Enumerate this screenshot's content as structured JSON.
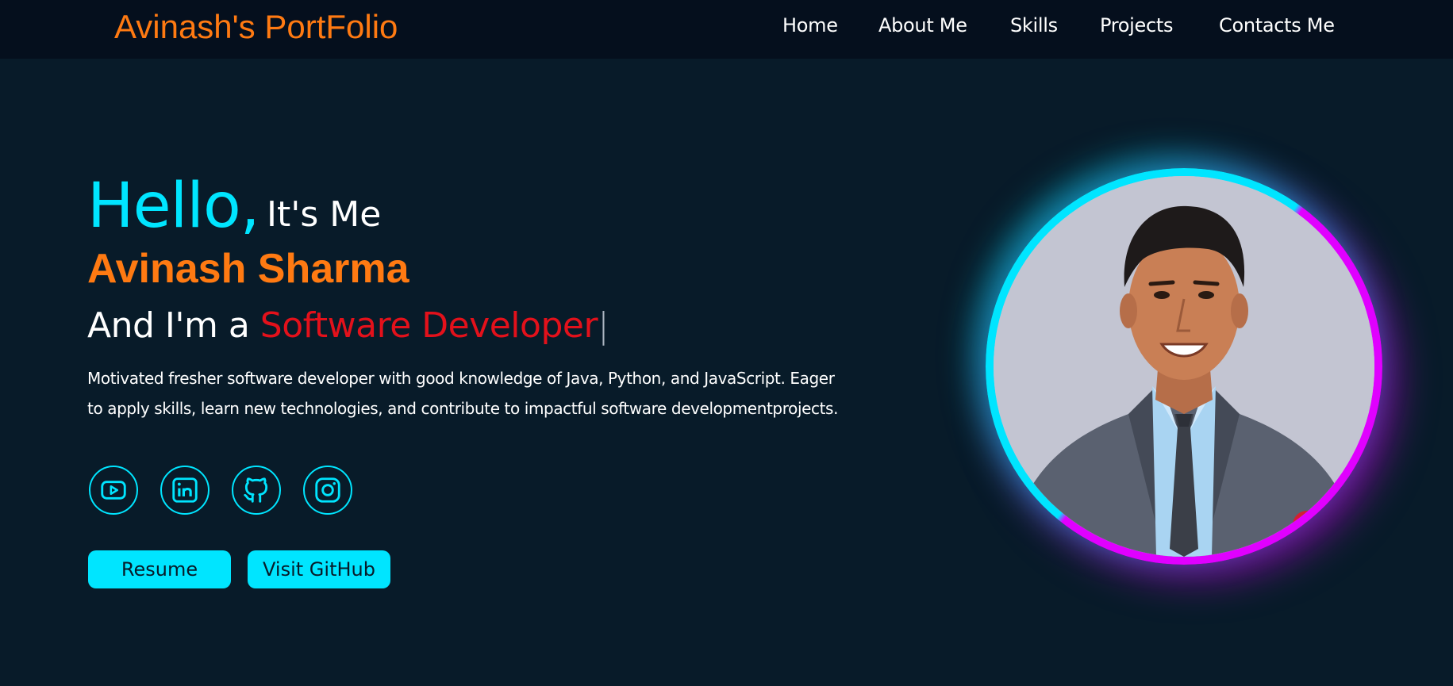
{
  "nav": {
    "logo": "Avinash's PortFolio",
    "links": [
      "Home",
      "About Me",
      "Skills",
      "Projects",
      "Contacts Me"
    ]
  },
  "hero": {
    "hello": "Hello,",
    "its_me": "It's Me",
    "name": "Avinash Sharma",
    "role_prefix": "And I'm a",
    "role_text": "Software Developer",
    "cursor": "|",
    "description": "Motivated fresher software developer with good knowledge of Java, Python, and JavaScript. Eager to apply skills, learn new technologies, and contribute to impactful software developmentprojects."
  },
  "socials": [
    {
      "icon": "youtube-icon"
    },
    {
      "icon": "linkedin-icon"
    },
    {
      "icon": "github-icon"
    },
    {
      "icon": "instagram-icon"
    }
  ],
  "buttons": {
    "resume": "Resume",
    "github": "Visit GitHub"
  },
  "colors": {
    "background": "#081b29",
    "navbar": "#050f1d",
    "accent_cyan": "#00e5ff",
    "accent_orange": "#ff7a12",
    "accent_red": "#e3111b",
    "accent_magenta": "#e000ff"
  }
}
